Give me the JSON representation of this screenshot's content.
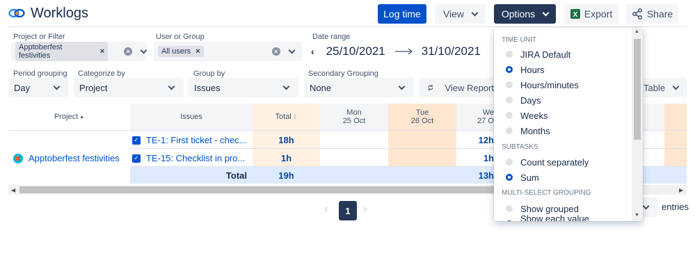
{
  "header": {
    "title": "Worklogs",
    "log_time": "Log time",
    "view": "View",
    "options": "Options",
    "export": "Export",
    "share": "Share"
  },
  "filters": {
    "project_label": "Project or Filter",
    "project_tag": "Apptoberfest festivities",
    "user_label": "User or Group",
    "user_tag": "All users",
    "date_label": "Date range",
    "date_from": "25/10/2021",
    "date_to": "31/10/2021",
    "period_label": "Period grouping",
    "period_value": "Day",
    "categorize_label": "Categorize by",
    "categorize_value": "Project",
    "group_label": "Group by",
    "group_value": "Issues",
    "secondary_label": "Secondary Grouping",
    "secondary_value": "None",
    "view_report": "View Report",
    "table_btn": "Table"
  },
  "table": {
    "columns": {
      "project": "Project",
      "issues": "Issues",
      "total": "Total",
      "mon": "Mon",
      "mon_date": "25 Oct",
      "tue": "Tue",
      "tue_date": "26 Oct",
      "wed": "We",
      "wed_date": "27 O"
    },
    "project_name": "Apptoberfest festivities",
    "rows": [
      {
        "issue": "TE-1: First ticket - chec...",
        "total": "18h",
        "wed": "12h"
      },
      {
        "issue": "TE-15: Checklist in pro...",
        "total": "1h",
        "wed": "1h"
      }
    ],
    "total_label": "Total",
    "total_value": "19h",
    "total_wed": "13h"
  },
  "pagination": {
    "current": "1",
    "entries": "entries"
  },
  "options_menu": {
    "time_unit_head": "TIME UNIT",
    "time_units": [
      "JIRA Default",
      "Hours",
      "Hours/minutes",
      "Days",
      "Weeks",
      "Months"
    ],
    "time_unit_selected": "Hours",
    "subtasks_head": "SUBTASKS",
    "subtasks": [
      "Count separately",
      "Sum"
    ],
    "subtasks_selected": "Sum",
    "multiselect_head": "MULTI-SELECT GROUPING",
    "multiselect": [
      "Show grouped",
      "Show each value separately"
    ]
  },
  "colors": {
    "primary": "#0052cc",
    "dark": "#253858",
    "weekend": "#ffe6d1",
    "total_col": "#fff0e1",
    "total_row": "#deebff",
    "excel_green": "#1e7145"
  }
}
